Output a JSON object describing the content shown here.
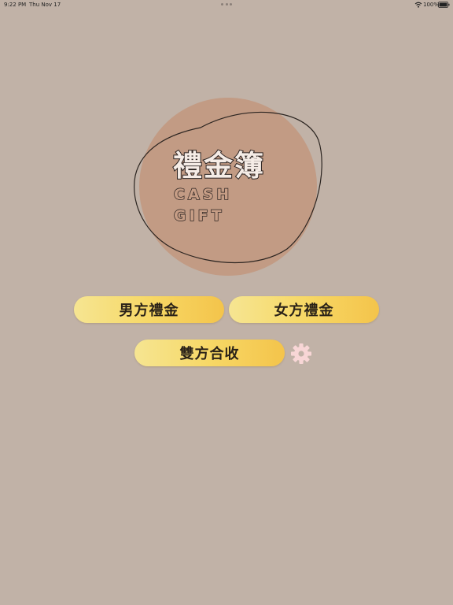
{
  "status_bar": {
    "time": "9:22 PM",
    "date": "Thu Nov 17",
    "battery": "100%",
    "icons": [
      "wifi-icon",
      "battery-icon"
    ]
  },
  "logo": {
    "title": "禮金簿",
    "line1": "CASH",
    "line2": "GIFT"
  },
  "buttons": {
    "groom": "男方禮金",
    "bride": "女方禮金",
    "both": "雙方合收"
  },
  "settings": {
    "icon": "gear-icon"
  },
  "colors": {
    "background": "#c1b2a7",
    "logo_circle": "#c29b84",
    "button_gradient_start": "#f6e592",
    "button_gradient_end": "#f4c44b",
    "gear": "#f8d6d6"
  }
}
